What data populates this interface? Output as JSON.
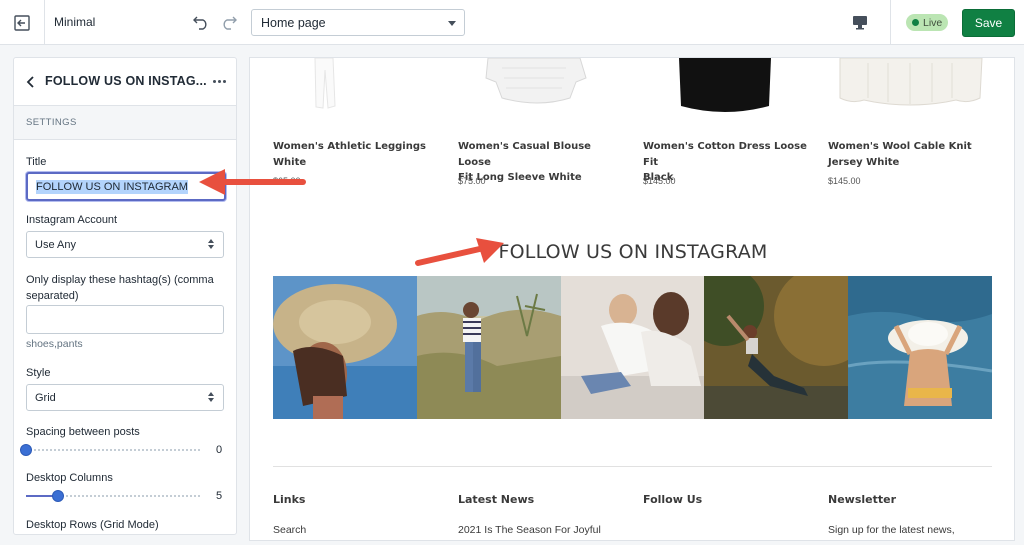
{
  "topbar": {
    "theme_name": "Minimal",
    "page_select": "Home page",
    "live_label": "Live",
    "save_label": "Save",
    "icons": [
      "exit-icon",
      "undo-icon",
      "redo-icon",
      "desktop-icon",
      "caret-down-icon"
    ]
  },
  "sidebar": {
    "title": "FOLLOW US ON INSTAG...",
    "section": "SETTINGS",
    "fields": {
      "title_label": "Title",
      "title_value": "FOLLOW US ON INSTAGRAM",
      "account_label": "Instagram Account",
      "account_value": "Use Any",
      "hashtag_label_1": "Only display these hashtag(s) (comma",
      "hashtag_label_2": "separated)",
      "hashtag_value": "",
      "hashtag_help": "shoes,pants",
      "style_label": "Style",
      "style_value": "Grid",
      "spacing_label": "Spacing between posts",
      "spacing_value": "0",
      "columns_label": "Desktop Columns",
      "columns_value": "5",
      "rows_label": "Desktop Rows (Grid Mode)"
    },
    "sliders": {
      "spacing_fraction": 0.0,
      "columns_fraction": 0.18
    }
  },
  "preview": {
    "products": [
      {
        "name_1": "Women's Athletic Leggings",
        "name_2": "White",
        "price": "$65.00"
      },
      {
        "name_1": "Women's Casual Blouse Loose",
        "name_2": "Fit Long Sleeve White",
        "price": "$75.00"
      },
      {
        "name_1": "Women's Cotton Dress Loose Fit",
        "name_2": "Black",
        "price": "$145.00"
      },
      {
        "name_1": "Women's Wool Cable Knit",
        "name_2": "Jersey White",
        "price": "$145.00"
      }
    ],
    "instagram_title": "FOLLOW US ON INSTAGRAM",
    "posts": [
      "straw-hat-portrait",
      "hiker-in-desert",
      "mother-and-daughter",
      "yoga-outdoors",
      "beach-hat"
    ],
    "footer": [
      {
        "heading": "Links",
        "text": "Search"
      },
      {
        "heading": "Latest News",
        "text": "2021 Is The Season For Joyful"
      },
      {
        "heading": "Follow Us",
        "text": ""
      },
      {
        "heading": "Newsletter",
        "text": "Sign up for the latest news,"
      }
    ]
  },
  "colors": {
    "accent": "#5c6ac4",
    "save": "#108043",
    "live_badge": "#bbe5b3",
    "annotation_arrow": "#e8503e"
  }
}
